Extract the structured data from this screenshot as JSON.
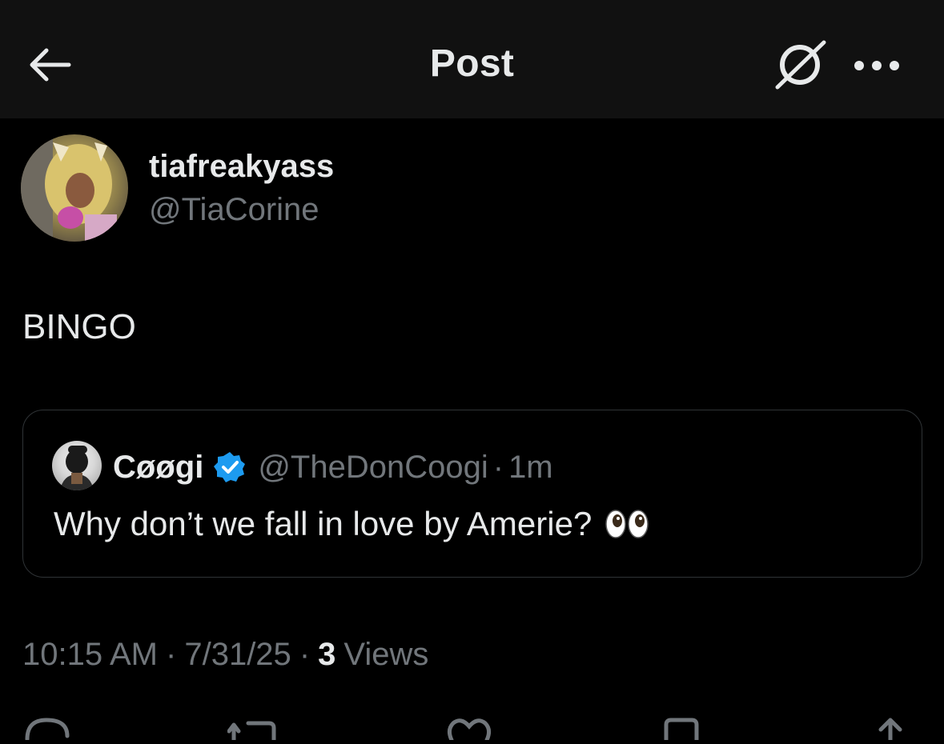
{
  "header": {
    "title": "Post",
    "back_icon": "arrow-left-icon",
    "grok_icon": "grok-icon",
    "more_icon": "more-horizontal-icon"
  },
  "post": {
    "author": {
      "display_name": "tiafreakyass",
      "handle": "@TiaCorine"
    },
    "text": "BINGO",
    "quote": {
      "author": {
        "display_name": "Cøøgi",
        "handle": "@TheDonCoogi",
        "verified": true
      },
      "separator": "·",
      "time": "1m",
      "text": "Why don’t we fall in love by Amerie?",
      "emoji": "eyes-emoji"
    },
    "meta": {
      "time": "10:15 AM",
      "separator": "·",
      "date": "7/31/25",
      "views_count": "3",
      "views_label": "Views"
    }
  },
  "actions": {
    "icons": [
      "reply-icon",
      "repost-icon",
      "like-icon",
      "bookmark-icon",
      "share-icon"
    ]
  },
  "colors": {
    "background": "#000000",
    "header_bg": "#111111",
    "primary_text": "#e7e9ea",
    "secondary_text": "#71767b",
    "border": "#2f3336",
    "verified_blue": "#1d9bf0"
  }
}
